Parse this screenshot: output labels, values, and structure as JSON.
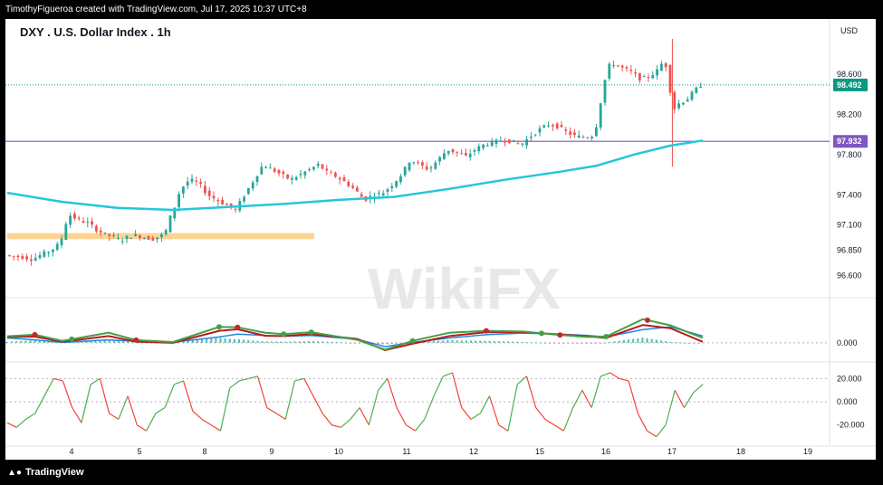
{
  "header": {
    "credit": "TimothyFigueroa created with TradingView.com, Jul 17, 2025 10:37 UTC+8"
  },
  "footer": {
    "brand": "TradingView"
  },
  "watermark": {
    "text": "WikiFX"
  },
  "colors": {
    "up": "#26a69a",
    "down": "#ef5350",
    "ma": "#26c6da",
    "hline": "#7e57c2",
    "zone": "#ffcc80",
    "macd_fast": "#43a047",
    "macd_slow": "#b71c1c",
    "macd_signal": "#1e88e5",
    "osc_up": "#4caf50",
    "osc_down": "#f44336",
    "last_price_tag": "#089981"
  },
  "chart_data": {
    "type": "candlestick",
    "title": "DXY . U.S. Dollar Index . 1h",
    "currency": "USD",
    "x_ticks": [
      "4",
      "5",
      "8",
      "9",
      "10",
      "11",
      "12",
      "15",
      "16",
      "17",
      "18",
      "19"
    ],
    "price_axis": {
      "ylim": [
        96.45,
        98.95
      ],
      "ticks": [
        "98.600",
        "98.200",
        "97.800",
        "97.400",
        "97.100",
        "96.850",
        "96.600"
      ],
      "tick_values": [
        98.6,
        98.2,
        97.8,
        97.4,
        97.1,
        96.85,
        96.6
      ]
    },
    "last_price": {
      "label": "98.492",
      "value": 98.492
    },
    "horizontal_line": {
      "label": "97.932",
      "value": 97.932
    },
    "support_zone": {
      "from": 96.96,
      "to": 97.02
    },
    "price_path": [
      [
        0,
        96.8
      ],
      [
        2,
        96.78
      ],
      [
        3,
        96.76
      ],
      [
        4,
        96.81
      ],
      [
        5,
        96.85
      ],
      [
        6,
        96.92
      ],
      [
        6.5,
        97.1
      ],
      [
        7,
        97.2
      ],
      [
        8,
        97.15
      ],
      [
        9,
        97.12
      ],
      [
        10,
        97.05
      ],
      [
        11,
        97.0
      ],
      [
        12,
        96.98
      ],
      [
        12.5,
        96.94
      ],
      [
        13,
        96.97
      ],
      [
        14,
        97.0
      ],
      [
        15,
        96.98
      ],
      [
        16,
        96.96
      ],
      [
        17,
        97.0
      ],
      [
        17.5,
        97.05
      ],
      [
        18,
        97.2
      ],
      [
        18.5,
        97.3
      ],
      [
        19,
        97.45
      ],
      [
        20,
        97.55
      ],
      [
        21,
        97.52
      ],
      [
        22,
        97.4
      ],
      [
        23,
        97.35
      ],
      [
        24,
        97.3
      ],
      [
        25,
        97.25
      ],
      [
        26,
        97.4
      ],
      [
        27,
        97.55
      ],
      [
        28,
        97.7
      ],
      [
        29,
        97.65
      ],
      [
        30,
        97.6
      ],
      [
        31,
        97.55
      ],
      [
        32,
        97.6
      ],
      [
        33,
        97.65
      ],
      [
        34,
        97.7
      ],
      [
        35,
        97.62
      ],
      [
        36,
        97.58
      ],
      [
        37,
        97.52
      ],
      [
        38,
        97.45
      ],
      [
        39,
        97.35
      ],
      [
        40,
        97.4
      ],
      [
        41,
        97.42
      ],
      [
        42,
        97.5
      ],
      [
        43,
        97.6
      ],
      [
        44,
        97.75
      ],
      [
        45,
        97.7
      ],
      [
        46,
        97.65
      ],
      [
        47,
        97.75
      ],
      [
        48,
        97.85
      ],
      [
        49,
        97.82
      ],
      [
        50,
        97.78
      ],
      [
        51,
        97.85
      ],
      [
        52,
        97.9
      ],
      [
        53,
        97.92
      ],
      [
        54,
        97.95
      ],
      [
        55,
        97.93
      ],
      [
        56,
        97.9
      ],
      [
        57,
        97.98
      ],
      [
        58,
        98.05
      ],
      [
        59,
        98.1
      ],
      [
        60,
        98.08
      ],
      [
        61,
        98.02
      ],
      [
        62,
        97.98
      ],
      [
        63,
        97.97
      ],
      [
        64,
        98.0
      ],
      [
        65,
        98.5
      ],
      [
        65.5,
        98.68
      ],
      [
        66,
        98.7
      ],
      [
        67,
        98.66
      ],
      [
        68,
        98.62
      ],
      [
        69,
        98.55
      ],
      [
        70,
        98.58
      ],
      [
        71,
        98.65
      ],
      [
        71.5,
        98.75
      ],
      [
        72,
        98.6
      ],
      [
        72.3,
        98.35
      ],
      [
        72.6,
        98.25
      ],
      [
        73,
        98.3
      ],
      [
        74,
        98.35
      ],
      [
        75,
        98.45
      ],
      [
        75.5,
        98.49
      ]
    ],
    "ma_path": [
      [
        0,
        97.42
      ],
      [
        6,
        97.33
      ],
      [
        12,
        97.27
      ],
      [
        18,
        97.25
      ],
      [
        24,
        97.28
      ],
      [
        30,
        97.31
      ],
      [
        36,
        97.35
      ],
      [
        42,
        97.38
      ],
      [
        48,
        97.46
      ],
      [
        54,
        97.55
      ],
      [
        60,
        97.63
      ],
      [
        64,
        97.69
      ],
      [
        68,
        97.8
      ],
      [
        72,
        97.89
      ],
      [
        75.5,
        97.94
      ]
    ],
    "macd": {
      "zero_label": "0.000",
      "fast_path": [
        [
          0,
          0.34
        ],
        [
          3,
          0.42
        ],
        [
          6,
          0.1
        ],
        [
          11,
          0.52
        ],
        [
          14,
          0.14
        ],
        [
          18,
          0.04
        ],
        [
          23,
          0.82
        ],
        [
          25,
          0.8
        ],
        [
          28,
          0.52
        ],
        [
          30,
          0.45
        ],
        [
          33,
          0.55
        ],
        [
          38,
          0.15
        ],
        [
          41,
          -0.35
        ],
        [
          44,
          0.1
        ],
        [
          48,
          0.52
        ],
        [
          52,
          0.62
        ],
        [
          56,
          0.58
        ],
        [
          60,
          0.4
        ],
        [
          63,
          0.3
        ],
        [
          65,
          0.32
        ],
        [
          69,
          1.22
        ],
        [
          72,
          0.9
        ],
        [
          75.5,
          0.25
        ]
      ],
      "slow_path": [
        [
          0,
          0.3
        ],
        [
          3,
          0.32
        ],
        [
          6,
          0.05
        ],
        [
          11,
          0.35
        ],
        [
          14,
          0.06
        ],
        [
          18,
          0.0
        ],
        [
          23,
          0.62
        ],
        [
          25,
          0.7
        ],
        [
          28,
          0.36
        ],
        [
          30,
          0.35
        ],
        [
          33,
          0.45
        ],
        [
          38,
          0.2
        ],
        [
          41,
          -0.38
        ],
        [
          44,
          -0.05
        ],
        [
          48,
          0.35
        ],
        [
          52,
          0.55
        ],
        [
          56,
          0.55
        ],
        [
          60,
          0.43
        ],
        [
          63,
          0.34
        ],
        [
          65,
          0.25
        ],
        [
          69,
          0.92
        ],
        [
          72,
          0.75
        ],
        [
          75.5,
          0.05
        ]
      ],
      "signal_path": [
        [
          0,
          0.25
        ],
        [
          3,
          0.15
        ],
        [
          6,
          0.02
        ],
        [
          11,
          0.15
        ],
        [
          14,
          0.08
        ],
        [
          18,
          0.03
        ],
        [
          23,
          0.3
        ],
        [
          25,
          0.45
        ],
        [
          28,
          0.38
        ],
        [
          30,
          0.34
        ],
        [
          33,
          0.38
        ],
        [
          38,
          0.18
        ],
        [
          41,
          -0.2
        ],
        [
          44,
          0.02
        ],
        [
          48,
          0.25
        ],
        [
          52,
          0.42
        ],
        [
          56,
          0.5
        ],
        [
          60,
          0.45
        ],
        [
          63,
          0.38
        ],
        [
          65,
          0.3
        ],
        [
          69,
          0.68
        ],
        [
          72,
          0.82
        ],
        [
          75.5,
          0.35
        ]
      ],
      "ylim": [
        -0.8,
        2.0
      ]
    },
    "oscillator": {
      "ticks": [
        "20.000",
        "0.000",
        "-20.000"
      ],
      "tick_values": [
        20,
        0,
        -20
      ],
      "ylim": [
        -35,
        32
      ],
      "values": [
        -18,
        -22,
        -15,
        -10,
        5,
        20,
        18,
        -5,
        -18,
        15,
        20,
        -10,
        -15,
        5,
        -20,
        -25,
        -10,
        -5,
        15,
        18,
        -8,
        -15,
        -20,
        -25,
        12,
        18,
        20,
        22,
        -5,
        -10,
        -15,
        18,
        20,
        5,
        -10,
        -20,
        -22,
        -15,
        -5,
        -20,
        10,
        20,
        -5,
        -20,
        -25,
        -15,
        5,
        22,
        25,
        -5,
        -15,
        -10,
        5,
        -20,
        -25,
        15,
        22,
        -5,
        -15,
        -20,
        -25,
        -5,
        10,
        -5,
        22,
        25,
        20,
        18,
        -10,
        -25,
        -30,
        -20,
        10,
        -5,
        8,
        15
      ]
    }
  }
}
